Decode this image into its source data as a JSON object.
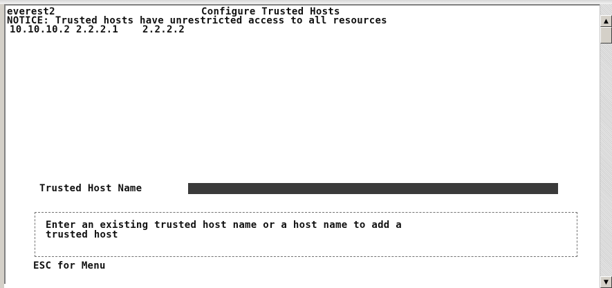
{
  "terminal": {
    "hostname": "everest2",
    "screen_title": "Configure Trusted Hosts",
    "notice": "NOTICE: Trusted hosts have unrestricted access to all resources",
    "hosts_line": "10.10.10.2 2.2.2.1    2.2.2.2",
    "field_label": "Trusted Host Name",
    "field_value": "",
    "help_line1": "Enter an existing trusted host name or a host name to add a",
    "help_line2": "trusted host",
    "esc_hint": "ESC for Menu"
  },
  "scrollbar": {
    "up_icon": "▲",
    "down_icon": "▼"
  }
}
